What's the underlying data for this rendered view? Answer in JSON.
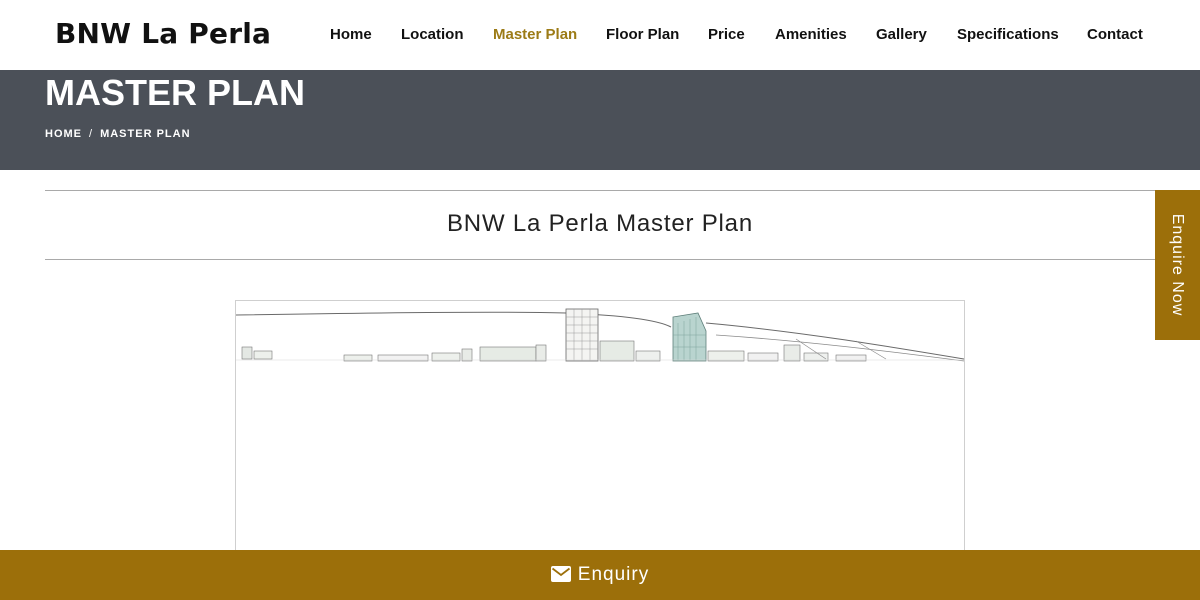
{
  "brand": {
    "logo_text": "BNW La Perla"
  },
  "nav": {
    "items": [
      {
        "label": "Home"
      },
      {
        "label": "Location"
      },
      {
        "label": "Master Plan",
        "active": true
      },
      {
        "label": "Floor Plan"
      },
      {
        "label": "Price"
      },
      {
        "label": "Amenities"
      },
      {
        "label": "Gallery"
      },
      {
        "label": "Specifications"
      },
      {
        "label": "Contact"
      }
    ]
  },
  "banner": {
    "title": "MASTER PLAN",
    "breadcrumb": {
      "home": "HOME",
      "separator": "/",
      "current": "MASTER PLAN"
    }
  },
  "section": {
    "title": "BNW La Perla Master Plan"
  },
  "side_tab": {
    "label": "Enquire Now"
  },
  "footer": {
    "label": "Enquiry",
    "icon": "envelope-icon"
  },
  "colors": {
    "accent": "#9c6f0a",
    "active_nav": "#9c7b16",
    "banner_bg": "#4b5058"
  }
}
